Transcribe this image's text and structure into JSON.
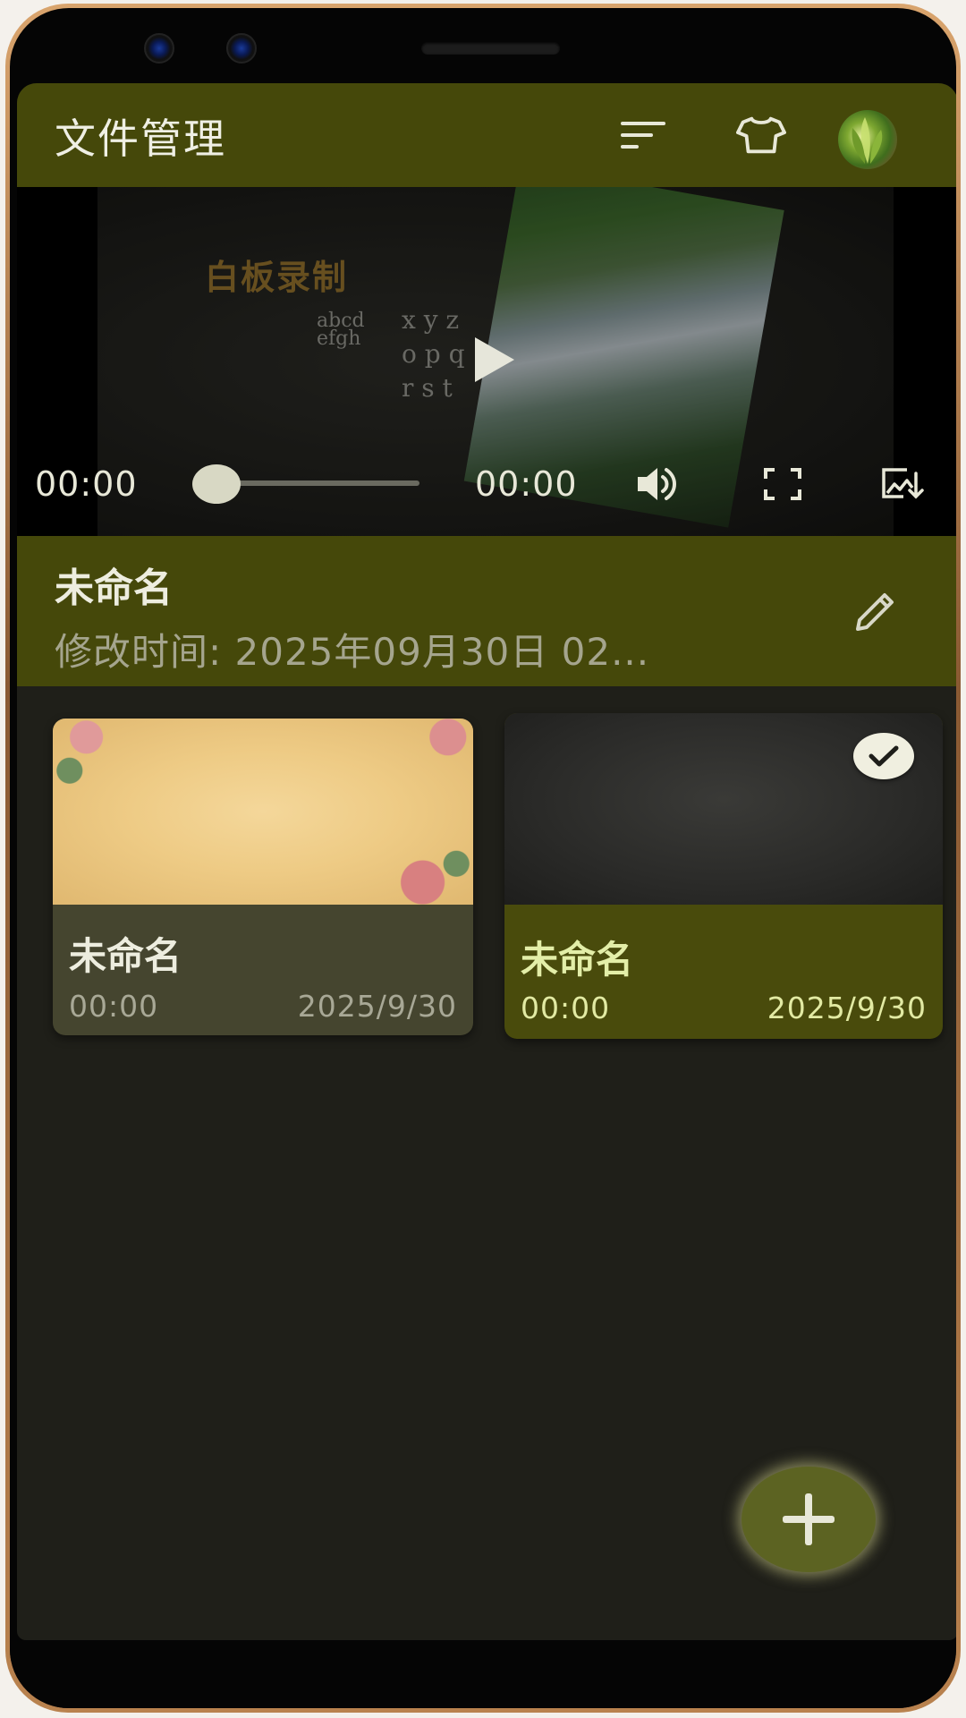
{
  "app_bar": {
    "title": "文件管理",
    "icons": [
      "sort-icon",
      "shirt-icon",
      "avatar"
    ]
  },
  "player": {
    "board_title": "白板录制",
    "board_letters": {
      "row1": "abcd",
      "row2": "efgh",
      "col_xyz": "x y z",
      "col_opq": "o p q",
      "col_rst": "r s t"
    },
    "current_time": "00:00",
    "total_time": "00:00",
    "progress": 0
  },
  "info": {
    "name": "未命名",
    "modified": "修改时间:  2025年09月30日  02..."
  },
  "cards": [
    {
      "title": "未命名",
      "duration": "00:00",
      "date": "2025/9/30",
      "selected": false
    },
    {
      "title": "未命名",
      "duration": "00:00",
      "date": "2025/9/30",
      "selected": true
    }
  ],
  "colors": {
    "accent": "#45480a",
    "background": "#1f1f19",
    "card": "#45452f",
    "selected_card": "#494b0c",
    "fab": "#5c6322"
  }
}
